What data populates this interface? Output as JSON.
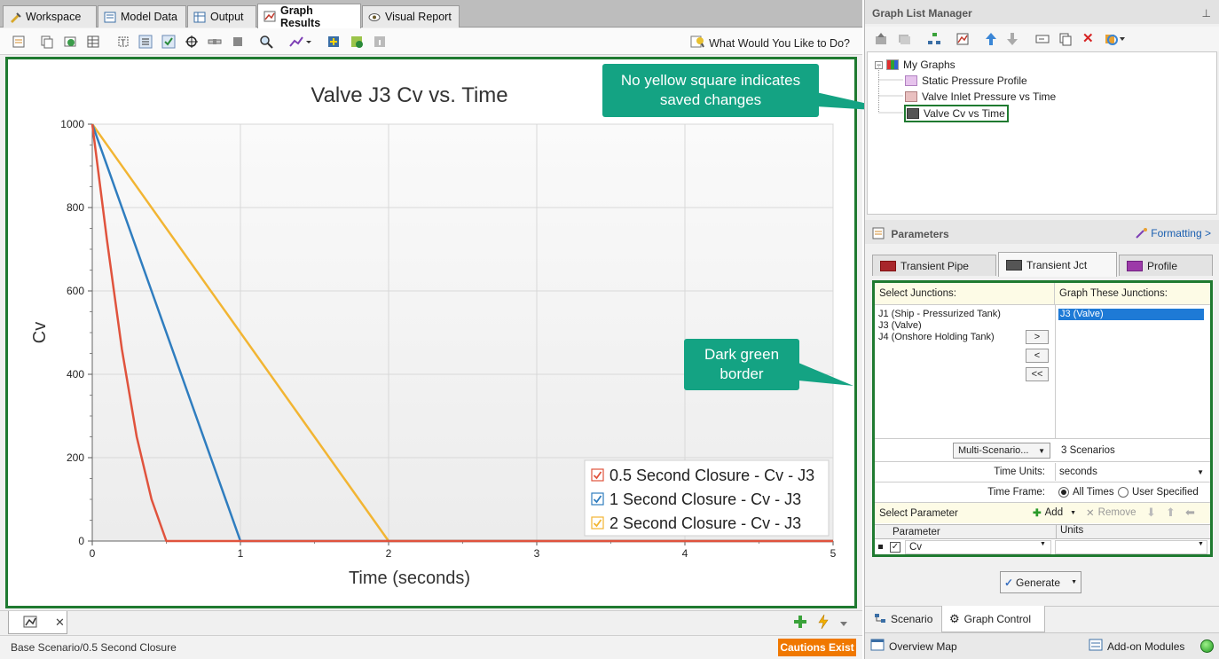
{
  "tabs": [
    {
      "label": "Workspace",
      "icon": "workspace-icon"
    },
    {
      "label": "Model Data",
      "icon": "model-data-icon"
    },
    {
      "label": "Output",
      "icon": "output-icon"
    },
    {
      "label": "Graph Results",
      "icon": "graph-results-icon",
      "active": true
    },
    {
      "label": "Visual Report",
      "icon": "visual-report-icon"
    }
  ],
  "toolbar": {
    "help_label": "What Would You Like to Do?"
  },
  "chart_data": {
    "type": "line",
    "title": "Valve J3 Cv vs. Time",
    "xlabel": "Time (seconds)",
    "ylabel": "Cv",
    "xlim": [
      0,
      5
    ],
    "ylim": [
      0,
      1000
    ],
    "xticks": [
      "0",
      "1",
      "2",
      "3",
      "4",
      "5"
    ],
    "yticks": [
      "0",
      "200",
      "400",
      "600",
      "800",
      "1000"
    ],
    "grid": true,
    "legend_position": "bottom-right",
    "series": [
      {
        "name": "0.5 Second Closure - Cv - J3",
        "color": "#e0533d",
        "points": [
          [
            0,
            1000
          ],
          [
            0.1,
            720
          ],
          [
            0.2,
            460
          ],
          [
            0.3,
            250
          ],
          [
            0.4,
            100
          ],
          [
            0.5,
            0
          ],
          [
            5,
            0
          ]
        ]
      },
      {
        "name": "1 Second Closure - Cv - J3",
        "color": "#2f7dbf",
        "points": [
          [
            0,
            1000
          ],
          [
            0.2,
            800
          ],
          [
            0.4,
            600
          ],
          [
            0.6,
            400
          ],
          [
            0.8,
            200
          ],
          [
            1,
            0
          ],
          [
            5,
            0
          ]
        ]
      },
      {
        "name": "2 Second Closure - Cv - J3",
        "color": "#f2b533",
        "points": [
          [
            0,
            1000
          ],
          [
            0.5,
            750
          ],
          [
            1,
            500
          ],
          [
            1.5,
            250
          ],
          [
            2,
            0
          ],
          [
            5,
            0
          ]
        ]
      }
    ]
  },
  "bottom": {
    "status_text": "Base Scenario/0.5 Second Closure",
    "cautions_label": "Cautions Exist",
    "cautions_color": "#f07800"
  },
  "callouts": {
    "yellow_square": "No yellow square indicates saved changes",
    "green_border": "Dark green border"
  },
  "graph_list": {
    "title": "Graph List Manager",
    "root": "My Graphs",
    "items": [
      "Static Pressure Profile",
      "Valve Inlet Pressure vs Time",
      "Valve Cv vs Time"
    ],
    "selected_index": 2
  },
  "params": {
    "title": "Parameters",
    "formatting_link": "Formatting >",
    "tabs": [
      "Transient Pipe",
      "Transient Jct",
      "Profile"
    ],
    "active_tab": "Transient Jct",
    "select_junctions_label": "Select Junctions:",
    "graph_these_label": "Graph These Junctions:",
    "available_junctions": [
      "J1 (Ship - Pressurized Tank)",
      "J3 (Valve)",
      "J4 (Onshore Holding Tank)"
    ],
    "selected_junctions": [
      "J3 (Valve)"
    ],
    "move_buttons": [
      ">",
      "<",
      "<<"
    ],
    "multi_scenario_label": "Multi-Scenario...",
    "scenarios_value": "3 Scenarios",
    "time_units_label": "Time Units:",
    "time_units_value": "seconds",
    "time_frame_label": "Time Frame:",
    "time_frame_options": [
      "All Times",
      "User Specified"
    ],
    "time_frame_selected": "All Times",
    "select_parameter_label": "Select Parameter",
    "add_label": "Add",
    "remove_label": "Remove",
    "grid_headers": [
      "Parameter",
      "Units"
    ],
    "parameter_value": "Cv",
    "units_value": ""
  },
  "generate_label": "Generate",
  "bottom_tabs": [
    "Scenario",
    "Graph Control"
  ],
  "overview_map_label": "Overview Map",
  "addon_label": "Add-on Modules"
}
